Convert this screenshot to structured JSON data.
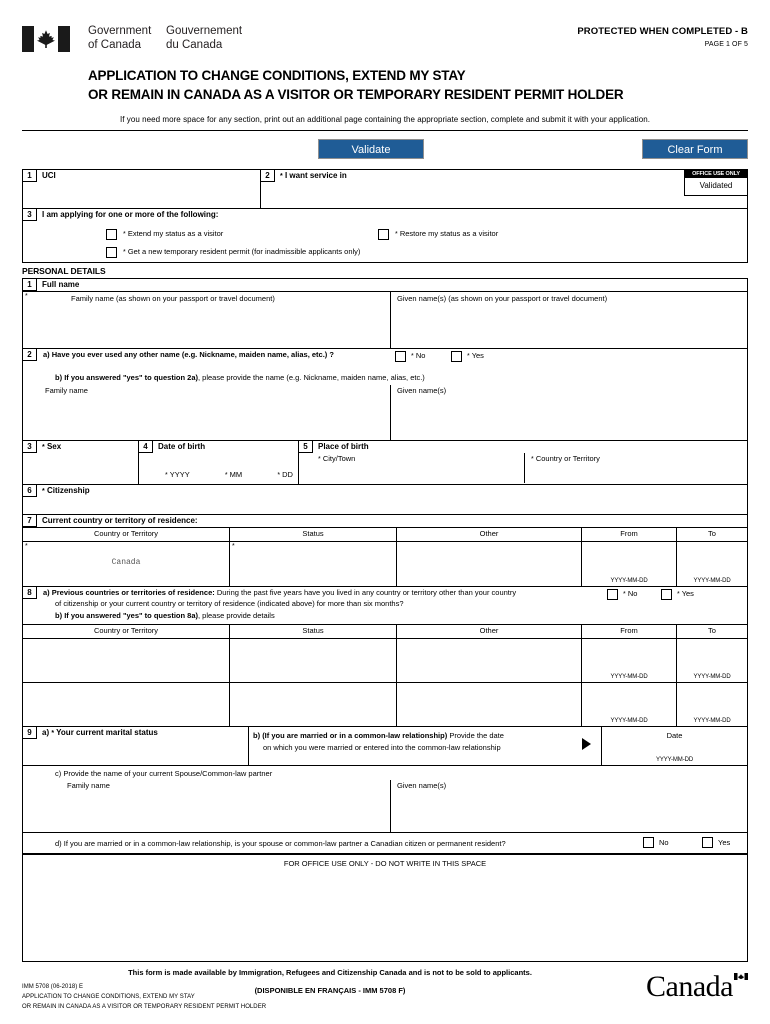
{
  "header": {
    "gov_en_line1": "Government",
    "gov_en_line2": "of Canada",
    "gov_fr_line1": "Gouvernement",
    "gov_fr_line2": "du Canada",
    "protected_label": "PROTECTED WHEN COMPLETED - B",
    "page_label": "PAGE 1 OF 5",
    "flag_icon": "canada-flag-icon"
  },
  "title": {
    "line1": "APPLICATION TO CHANGE CONDITIONS, EXTEND MY STAY",
    "line2": "OR REMAIN IN CANADA AS A VISITOR OR TEMPORARY RESIDENT PERMIT HOLDER",
    "note": "If you need more space for any section, print out an additional page containing the appropriate section, complete and submit it with your application."
  },
  "toolbar": {
    "validate_label": "Validate",
    "clear_label": "Clear Form",
    "button_color": "#1F5C96"
  },
  "office_use": {
    "header": "OFFICE USE ONLY",
    "value": "Validated"
  },
  "q1": {
    "num": "1",
    "label": "UCI",
    "value": ""
  },
  "q2": {
    "num": "2",
    "star": "*",
    "label": "I want service in",
    "value": ""
  },
  "q3": {
    "num": "3",
    "label": "I am applying for one or more of the following:",
    "options": [
      {
        "star": "*",
        "label": "Extend my status as a visitor",
        "checked": false
      },
      {
        "star": "*",
        "label": "Restore my status as a visitor",
        "checked": false
      },
      {
        "star": "*",
        "label": "Get a new temporary resident permit (for inadmissible applicants only)",
        "checked": false
      }
    ]
  },
  "personal_details": {
    "section_title": "PERSONAL DETAILS",
    "q1": {
      "num": "1",
      "label": "Full name",
      "star": "*",
      "family_label": "Family name (as shown on your passport or travel document)",
      "given_label": "Given name(s) (as shown on your passport or travel document)",
      "family_value": "",
      "given_value": ""
    },
    "q2": {
      "num": "2",
      "a_prefix": "a)",
      "a_label": "Have you ever used any other name (e.g. Nickname, maiden name, alias, etc.) ?",
      "no_label": "No",
      "yes_label": "Yes",
      "star": "*",
      "b_prefix": "b)",
      "b_label_bold": "If you answered \"yes\" to question 2a)",
      "b_label_rest": ", please provide the name (e.g. Nickname, maiden name, alias, etc.)",
      "family_label": "Family name",
      "given_label": "Given name(s)",
      "family_value": "",
      "given_value": ""
    },
    "q3": {
      "num": "3",
      "star": "*",
      "label": "Sex",
      "value": ""
    },
    "q4": {
      "num": "4",
      "label": "Date of birth",
      "yyyy": "YYYY",
      "mm": "MM",
      "dd": "DD",
      "star": "*",
      "value": ""
    },
    "q5": {
      "num": "5",
      "label": "Place of birth",
      "city_label": "City/Town",
      "country_label": "Country or Territory",
      "star": "*",
      "city_value": "",
      "country_value": ""
    },
    "q6": {
      "num": "6",
      "star": "*",
      "label": "Citizenship",
      "value": ""
    },
    "q7": {
      "num": "7",
      "label": "Current country or territory of residence:",
      "columns": [
        "Country or Territory",
        "Status",
        "Other",
        "From",
        "To"
      ],
      "date_hint": "YYYY-MM-DD",
      "rows": [
        {
          "country": "Canada",
          "status": "",
          "other": "",
          "from": "",
          "to": ""
        }
      ]
    },
    "q8": {
      "num": "8",
      "a_prefix": "a)",
      "a_label_bold": "Previous countries or territories of residence:",
      "a_label_line1": "During the past five years have you lived in any country or territory other than your country",
      "a_label_line2": "of citizenship or your current country or territory of residence (indicated above) for more than six months?",
      "no_label": "No",
      "yes_label": "Yes",
      "star": "*",
      "b_prefix": "b)",
      "b_label_bold": "If you answered \"yes\" to question 8a)",
      "b_label_rest": ", please provide details",
      "columns": [
        "Country or Territory",
        "Status",
        "Other",
        "From",
        "To"
      ],
      "date_hint": "YYYY-MM-DD",
      "rows": [
        {
          "country": "",
          "status": "",
          "other": "",
          "from": "",
          "to": ""
        },
        {
          "country": "",
          "status": "",
          "other": "",
          "from": "",
          "to": ""
        }
      ]
    },
    "q9": {
      "num": "9",
      "a_prefix": "a)",
      "a_star": "*",
      "a_label": "Your current marital status",
      "a_value": "",
      "b_prefix": "b)",
      "b_bold": "(If you are married or in a common-law relationship)",
      "b_rest_line1": " Provide the date",
      "b_rest_line2": "on which you were married or entered into the common-law relationship",
      "date_label": "Date",
      "date_hint": "YYYY-MM-DD",
      "date_value": "",
      "arrow_icon": "triangle-right-icon",
      "c_prefix": "c)",
      "c_label": "Provide the name of your current Spouse/Common-law partner",
      "c_family_label": "Family name",
      "c_given_label": "Given name(s)",
      "c_family_value": "",
      "c_given_value": "",
      "d_prefix": "d)",
      "d_label": "If you are married or in a common-law relationship, is your spouse or common-law partner a Canadian citizen or permanent resident?",
      "d_no_label": "No",
      "d_yes_label": "Yes"
    }
  },
  "office_space": {
    "caption": "FOR OFFICE USE ONLY - DO NOT WRITE IN THIS SPACE"
  },
  "footer": {
    "availability": "This form is made available by Immigration, Refugees and Citizenship Canada and is not to be sold to applicants.",
    "french_version": "(DISPONIBLE EN FRANÇAIS - IMM 5708 F)",
    "form_code": "IMM 5708 (06-2018) E",
    "form_title_line1": "APPLICATION TO CHANGE CONDITIONS, EXTEND MY STAY",
    "form_title_line2": "OR REMAIN IN CANADA AS A VISITOR OR TEMPORARY RESIDENT PERMIT HOLDER",
    "wordmark": "Canada",
    "wordmark_flag_icon": "canada-flag-icon"
  }
}
